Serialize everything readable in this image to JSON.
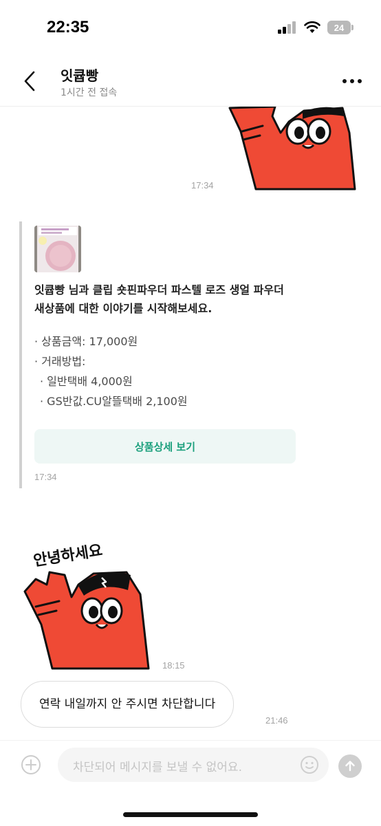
{
  "status_bar": {
    "time": "22:35",
    "battery": "24"
  },
  "header": {
    "name": "잇큡빵",
    "last_seen": "1시간 전 접속"
  },
  "messages": {
    "sticker1_time": "17:34",
    "product_card": {
      "title": "잇큡빵 님과 클립 숏핀파우더 파스텔 로즈 생얼 파우더 새상품에 대한 이야기를 시작해보세요.",
      "details": [
        "· 상품금액: 17,000원",
        "· 거래방법:",
        "· 일반택배 4,000원",
        "· GS반값.CU알뜰택배 2,100원"
      ],
      "button_label": "상품상세 보기",
      "time": "17:34"
    },
    "sticker2": {
      "caption": "안녕하세요",
      "time": "18:15"
    },
    "text_message": {
      "text": "연락 내일까지 안 주시면 차단합니다",
      "time": "21:46"
    }
  },
  "input": {
    "placeholder": "차단되어 메시지를 보낼 수 없어요."
  },
  "colors": {
    "accent": "#1a9f7c",
    "sticker_red": "#ef4a35"
  }
}
